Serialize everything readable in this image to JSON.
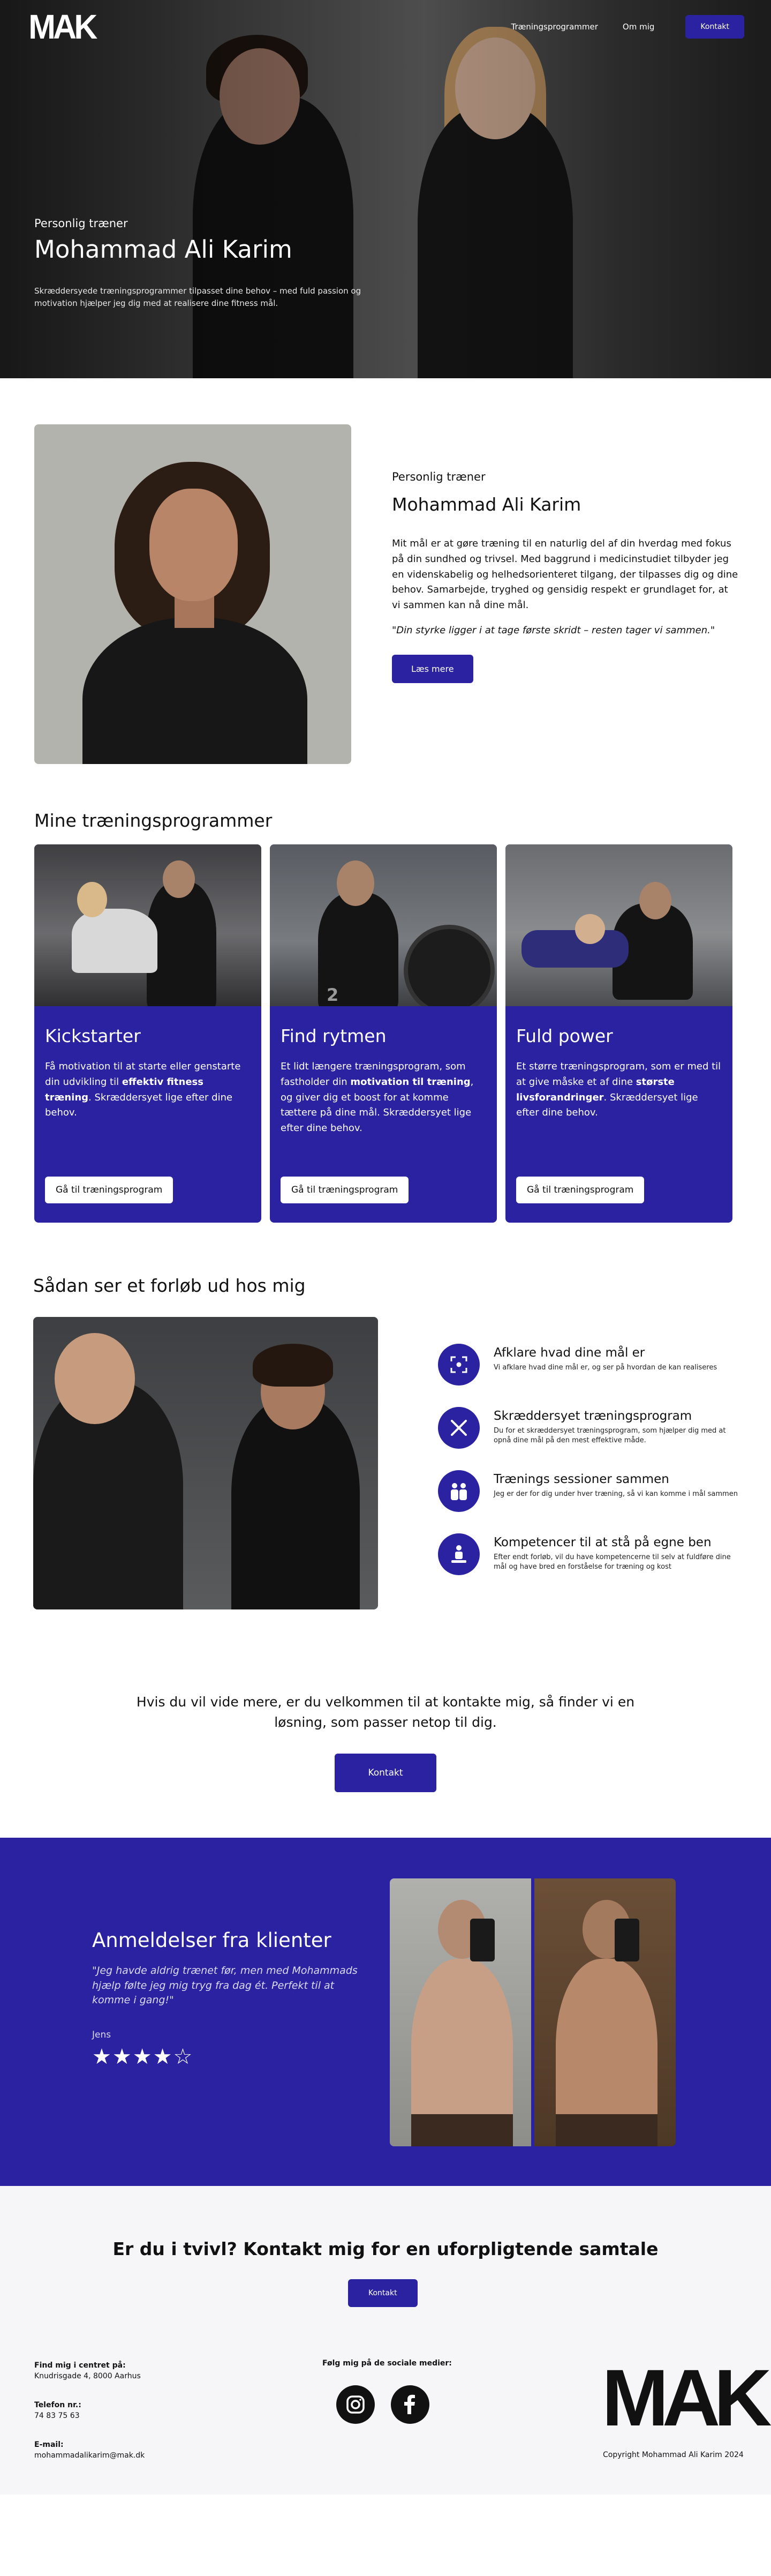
{
  "brand": {
    "logo": "MAK",
    "accent": "#2a22a0"
  },
  "nav": {
    "items": [
      {
        "label": "Træningsprogrammer"
      },
      {
        "label": "Om mig"
      }
    ],
    "cta": "Kontakt"
  },
  "hero": {
    "kicker": "Personlig træner",
    "title": "Mohammad Ali Karim",
    "description": "Skræddersyede træningsprogrammer tilpasset dine behov – med fuld passion og motivation hjælper jeg dig med at realisere dine fitness mål."
  },
  "about": {
    "kicker": "Personlig træner",
    "title": "Mohammad Ali Karim",
    "body": "Mit mål er at gøre træning til en naturlig del af din hverdag med fokus på din sundhed og trivsel. Med baggrund i medicinstudiet tilbyder jeg en videnskabelig og helhedsorienteret tilgang, der tilpasses dig og dine behov. Samarbejde, tryghed og gensidig respekt er grundlaget for, at vi sammen kan nå dine mål.",
    "quote": "\"Din styrke ligger i at tage første skridt – resten tager vi sammen.\"",
    "button": "Læs mere"
  },
  "programs": {
    "heading": "Mine træningsprogrammer",
    "cards": [
      {
        "title": "Kickstarter",
        "desc_a": "Få motivation til at starte eller genstarte din udvikling til ",
        "desc_bold": "effektiv fitness træning",
        "desc_b": ". Skræddersyet lige efter dine behov.",
        "button": "Gå til træningsprogram"
      },
      {
        "title": "Find rytmen",
        "desc_a": "Et lidt længere træningsprogram, som fastholder din ",
        "desc_bold": "motivation til træning",
        "desc_b": ", og giver dig et boost for at komme tættere på dine mål. Skræddersyet lige efter dine behov.",
        "button": "Gå til træningsprogram"
      },
      {
        "title": "Fuld power",
        "desc_a": "Et større træningsprogram, som er med til at give måske et af dine ",
        "desc_bold": "største livsforandringer",
        "desc_b": ". Skræddersyet lige efter dine behov.",
        "button": "Gå til træningsprogram"
      }
    ],
    "plate_number": "2"
  },
  "process": {
    "heading": "Sådan ser et forløb ud hos mig",
    "steps": [
      {
        "icon": "focus-icon",
        "title": "Afklare hvad dine mål er",
        "desc": "Vi afklare hvad dine mål er, og ser på hvordan de kan realiseres"
      },
      {
        "icon": "tools-icon",
        "title": "Skræddersyet træningsprogram",
        "desc": "Du for et skræddersyet træningsprogram, som hjælper dig med at opnå dine mål på den mest effektive måde."
      },
      {
        "icon": "people-icon",
        "title": "Trænings sessioner sammen",
        "desc": "Jeg er der for dig under hver træning, så vi kan komme i mål sammen"
      },
      {
        "icon": "person-up-icon",
        "title": "Kompetencer til at stå på egne ben",
        "desc": "Efter endt forløb, vil du have kompetencerne til selv at fuldføre dine mål og have bred en forståelse for træning og kost"
      }
    ],
    "cta_text": "Hvis du vil vide mere, er du velkommen til at kontakte mig, så finder vi en løsning, som passer netop til dig.",
    "cta_button": "Kontakt"
  },
  "reviews": {
    "heading": "Anmeldelser fra klienter",
    "quote": "\"Jeg havde aldrig trænet før, men med Mohammads hjælp følte jeg mig tryg fra dag ét. Perfekt til at komme i gang!\"",
    "author": "Jens",
    "stars": "★★★★☆",
    "rating": 4
  },
  "contact": {
    "heading": "Er du i tvivl? Kontakt mig for en uforpligtende samtale",
    "button": "Kontakt"
  },
  "footer": {
    "find_label": "Find mig i centret på:",
    "address": "Knudrisgade 4, 8000 Aarhus",
    "phone_label": "Telefon nr.:",
    "phone": "74 83 75 63",
    "email_label": "E-mail:",
    "email": "mohammadalikarim@mak.dk",
    "social_label": "Følg mig på de sociale medier:",
    "copyright": "Copyright Mohammad Ali Karim 2024"
  }
}
